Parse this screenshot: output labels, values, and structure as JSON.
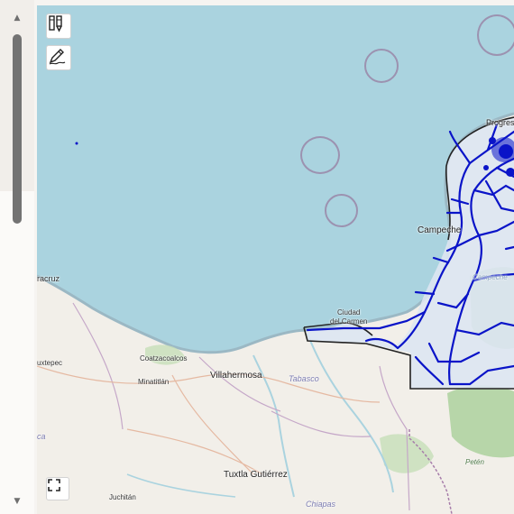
{
  "map": {
    "labels": {
      "progreso": "Progreso",
      "campeche": "Campeche",
      "ciudad_del_carmen": "Ciudad\ndel Carmen",
      "veracruz_partial": "racruz",
      "tuxtepec_partial": "uxtepec",
      "coatzacoalcos": "Coatzacoalcos",
      "minatitlan": "Minatitlán",
      "villahermosa": "Villahermosa",
      "tabasco": "Tabasco",
      "tuxtla": "Tuxtla Gutiérrez",
      "juchitan": "Juchitán",
      "chiapas": "Chiapas",
      "peten": "Petén",
      "oaxaca_partial": "ca",
      "campeche_region": "Campeche"
    },
    "controls": {
      "layers_icon": "layers-icon",
      "draw_icon": "pencil-icon",
      "fullscreen_icon": "fullscreen-icon"
    },
    "colors": {
      "sea": "#aad3df",
      "land": "#f2efe9",
      "forest": "#add19e",
      "overlay_route": "#0a14c8",
      "overlay_fill": "#dde6f2",
      "boundary": "#222222"
    }
  },
  "scrollbar": {
    "up_arrow": "▲",
    "down_arrow": "▼"
  }
}
